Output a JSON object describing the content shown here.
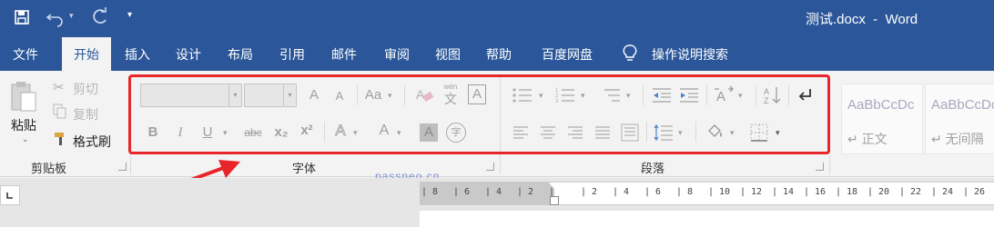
{
  "titlebar": {
    "save_icon": "save-icon",
    "undo_icon": "undo-icon",
    "redo_icon": "redo-icon",
    "customize_icon": "customize-qat-icon",
    "document_title": "测试.docx  -  Word"
  },
  "tabs": [
    "文件",
    "开始",
    "插入",
    "设计",
    "布局",
    "引用",
    "邮件",
    "审阅",
    "视图",
    "帮助",
    "百度网盘"
  ],
  "active_tab": "开始",
  "tell_me": {
    "icon": "lightbulb-icon",
    "label": "操作说明搜索"
  },
  "clipboard": {
    "paste_label": "粘贴",
    "cut_label": "剪切",
    "copy_label": "复制",
    "format_painter_label": "格式刷",
    "group_label": "剪贴板"
  },
  "font": {
    "group_label": "字体",
    "font_name": "",
    "font_size": "",
    "grow_label": "A",
    "shrink_label": "A",
    "case_label": "Aa",
    "phonetic_label": "wén",
    "phonetic_char": "文",
    "border_char_label": "A",
    "bold_label": "B",
    "italic_label": "I",
    "underline_label": "U",
    "strike_label": "abc",
    "subscript_label": "x₂",
    "superscript_label": "x²",
    "effects_label": "A",
    "color_label": "A",
    "shading_label": "A",
    "enclose_label": "字"
  },
  "paragraph": {
    "group_label": "段落"
  },
  "styles": [
    {
      "sample": "AaBbCcDc",
      "name": "↵ 正文"
    },
    {
      "sample": "AaBbCcDc",
      "name": "↵ 无间隔"
    }
  ],
  "watermark": "passneo.cn",
  "ruler": {
    "ticks": [
      "8",
      "6",
      "4",
      "2",
      "",
      "2",
      "4",
      "6",
      "8",
      "10",
      "12",
      "14",
      "16",
      "18",
      "20",
      "22",
      "24",
      "26"
    ]
  },
  "highlight_color": "#e8262a",
  "accent_color": "#2b579a"
}
